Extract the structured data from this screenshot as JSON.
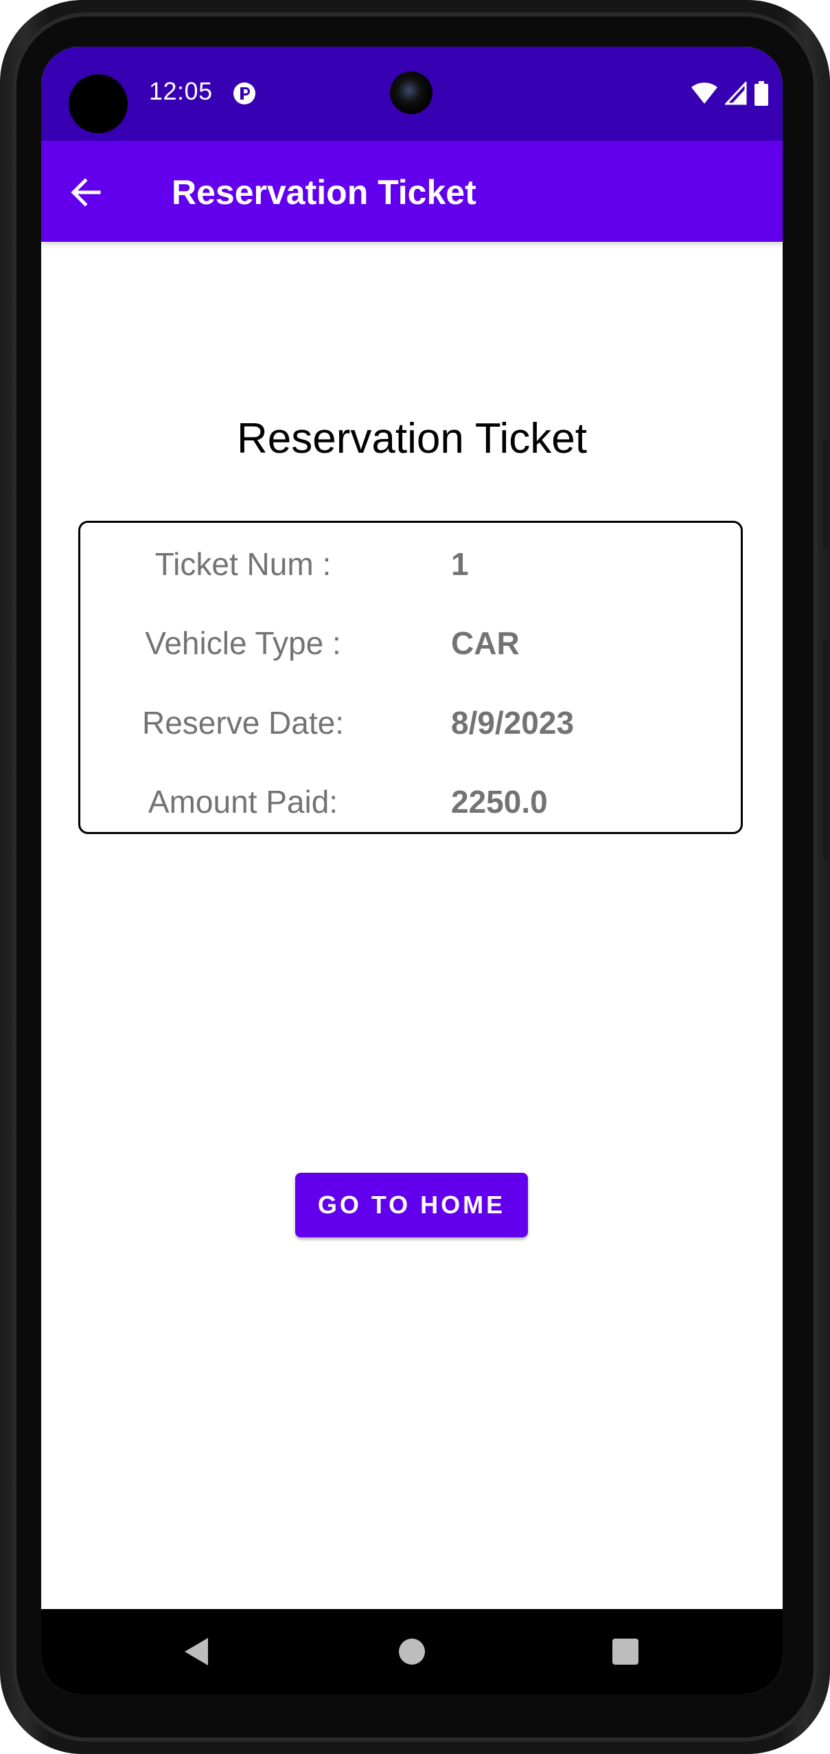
{
  "status_bar": {
    "time": "12:05",
    "app_icon": "play-protect-icon",
    "indicators": [
      "wifi-icon",
      "cellular-signal-icon",
      "battery-icon"
    ],
    "background_color": "#3700b3"
  },
  "app_bar": {
    "title": "Reservation Ticket",
    "back_icon": "arrow-left-icon",
    "background_color": "#6200ee"
  },
  "main": {
    "heading": "Reservation Ticket",
    "ticket": {
      "rows": [
        {
          "label": "Ticket Num :",
          "value": "1"
        },
        {
          "label": "Vehicle Type :",
          "value": "CAR"
        },
        {
          "label": "Reserve Date:",
          "value": "8/9/2023"
        },
        {
          "label": "Amount Paid:",
          "value": "2250.0"
        }
      ]
    },
    "home_button_label": "GO TO HOME",
    "accent_color": "#6200ee"
  },
  "nav_bar": {
    "buttons": [
      "nav-back-icon",
      "nav-home-icon",
      "nav-recents-icon"
    ]
  }
}
